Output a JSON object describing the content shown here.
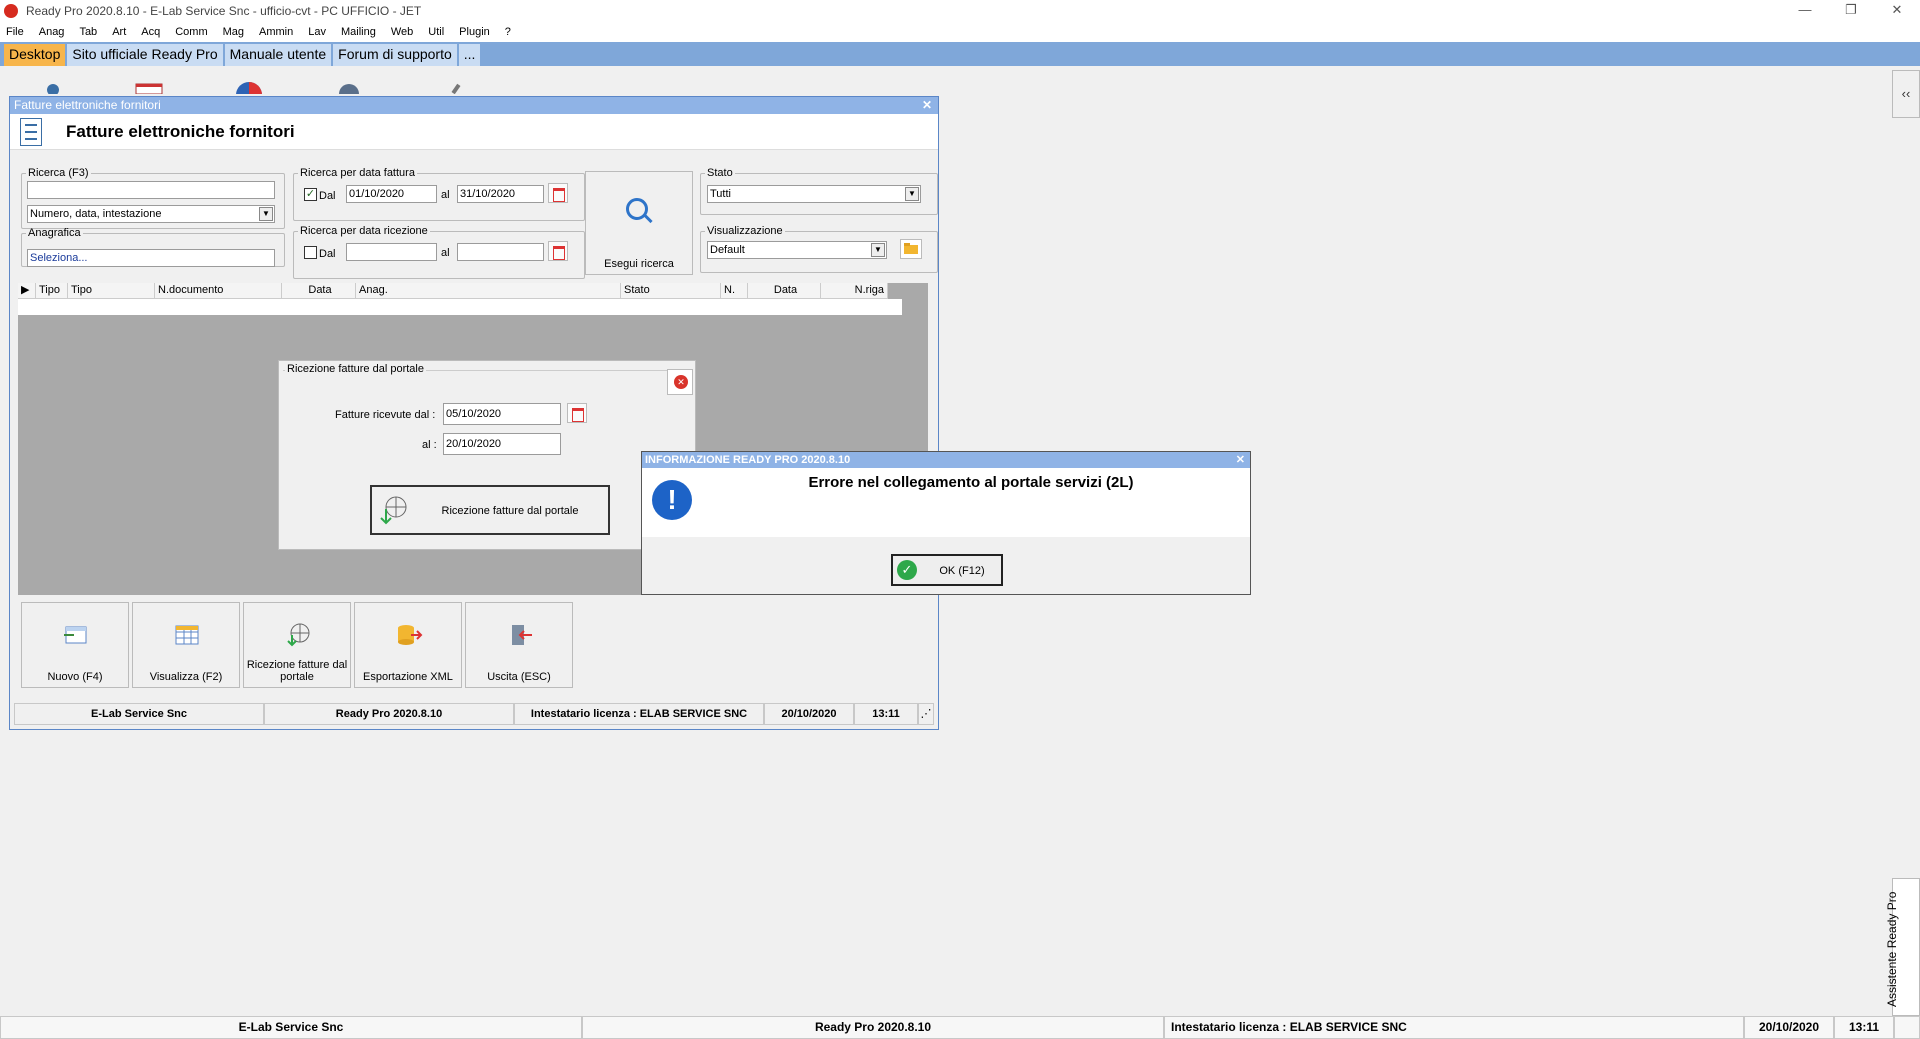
{
  "window": {
    "title": "Ready Pro 2020.8.10 - E-Lab Service Snc - ufficio-cvt - PC UFFICIO - JET",
    "min": "—",
    "restore": "❐",
    "close": "✕"
  },
  "menu": [
    "File",
    "Anag",
    "Tab",
    "Art",
    "Acq",
    "Comm",
    "Mag",
    "Ammin",
    "Lav",
    "Mailing",
    "Web",
    "Util",
    "Plugin",
    "?"
  ],
  "links": [
    "Desktop",
    "Sito ufficiale Ready Pro",
    "Manuale utente",
    "Forum di supporto",
    "..."
  ],
  "side": {
    "collapse": "‹‹",
    "assistant": "Assistente Ready Pro"
  },
  "main": {
    "caption": "Fatture elettroniche fornitori",
    "close": "✕",
    "heading": "Fatture elettroniche fornitori",
    "search": {
      "legend": "Ricerca (F3)",
      "value": "",
      "mode": "Numero, data, intestazione"
    },
    "anagrafica": {
      "legend": "Anagrafica",
      "value": "Seleziona..."
    },
    "date_invoice": {
      "legend": "Ricerca per data fattura",
      "checked": true,
      "dal_label": "Dal",
      "from": "01/10/2020",
      "al_label": "al",
      "to": "31/10/2020"
    },
    "date_receipt": {
      "legend": "Ricerca per data ricezione",
      "checked": false,
      "dal_label": "Dal",
      "from": "",
      "al_label": "al",
      "to": ""
    },
    "search_button": "Esegui ricerca",
    "stato": {
      "legend": "Stato",
      "value": "Tutti"
    },
    "view": {
      "legend": "Visualizzazione",
      "value": "Default"
    },
    "columns": [
      "Tipo",
      "Tipo",
      "N.documento",
      "Data",
      "Anag.",
      "Stato",
      "N.",
      "Data",
      "N.riga"
    ],
    "toolbar": [
      {
        "label": "Nuovo (F4)"
      },
      {
        "label": "Visualizza (F2)"
      },
      {
        "label": "Ricezione fatture dal portale"
      },
      {
        "label": "Esportazione XML"
      },
      {
        "label": "Uscita (ESC)"
      }
    ],
    "status": [
      "E-Lab Service Snc",
      "Ready Pro 2020.8.10",
      "Intestatario licenza : ELAB SERVICE SNC",
      "20/10/2020",
      "13:11"
    ]
  },
  "portal": {
    "title": "Ricezione fatture dal portale",
    "from_label": "Fatture ricevute dal :",
    "from": "05/10/2020",
    "to_label": "al :",
    "to": "20/10/2020",
    "button": "Ricezione fatture dal portale"
  },
  "info": {
    "caption": "INFORMAZIONE READY PRO 2020.8.10",
    "close": "✕",
    "icon": "!",
    "message": "Errore nel collegamento al portale servizi (2L)",
    "ok": "OK (F12)"
  },
  "statusbar": [
    "E-Lab Service Snc",
    "Ready Pro 2020.8.10",
    "Intestatario licenza : ELAB SERVICE SNC",
    "20/10/2020",
    "13:11"
  ]
}
